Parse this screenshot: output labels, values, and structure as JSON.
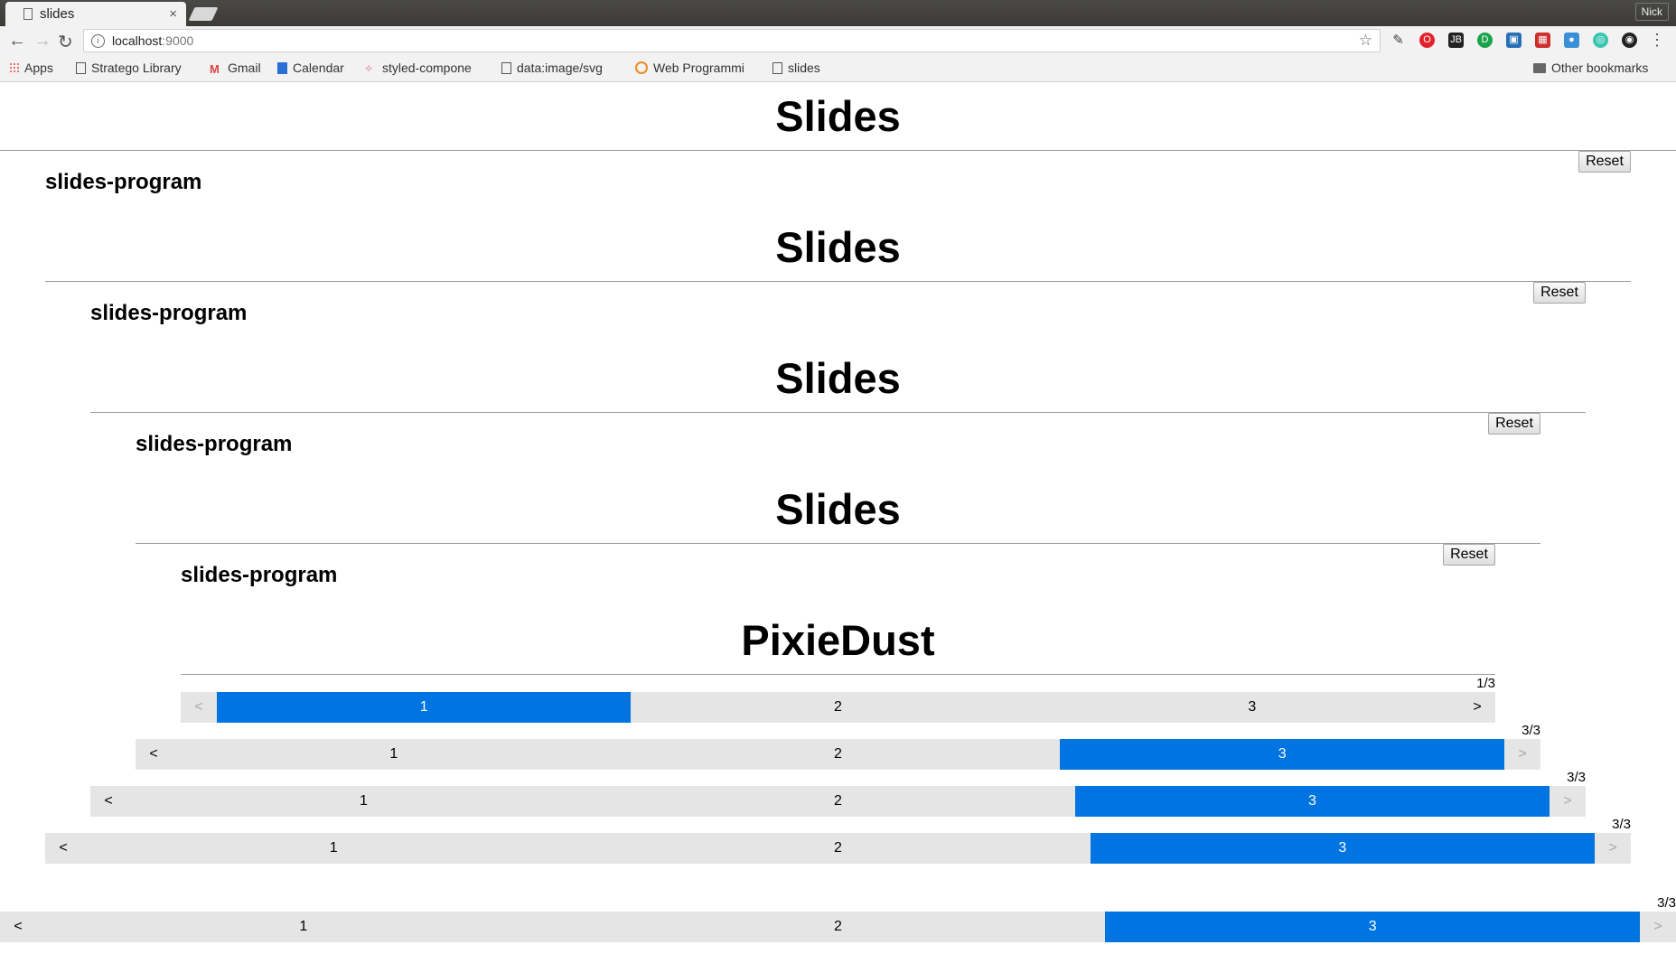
{
  "browser": {
    "tab_title": "slides",
    "tab_close": "×",
    "user": "Nick",
    "url_host": "localhost",
    "url_port": ":9000",
    "bookmarks": [
      "Apps",
      "Stratego Library",
      "Gmail",
      "Calendar",
      "styled-compone",
      "data:image/svg",
      "Web Programmi",
      "slides"
    ],
    "other_bookmarks": "Other bookmarks"
  },
  "headings": {
    "slides": "Slides",
    "program": "slides-program",
    "pixiedust": "PixieDust"
  },
  "buttons": {
    "reset": "Reset"
  },
  "pagers": [
    {
      "counter": "1/3",
      "prev": "<",
      "next": ">",
      "items": [
        "1",
        "2",
        "3"
      ],
      "active": 1
    },
    {
      "counter": "3/3",
      "prev": "<",
      "next": ">",
      "items": [
        "1",
        "2",
        "3"
      ],
      "active": 3
    },
    {
      "counter": "3/3",
      "prev": "<",
      "next": ">",
      "items": [
        "1",
        "2",
        "3"
      ],
      "active": 3
    },
    {
      "counter": "3/3",
      "prev": "<",
      "next": ">",
      "items": [
        "1",
        "2",
        "3"
      ],
      "active": 3
    },
    {
      "counter": "3/3",
      "prev": "<",
      "next": ">",
      "items": [
        "1",
        "2",
        "3"
      ],
      "active": 3
    }
  ],
  "colors": {
    "active": "#0074e0",
    "pager_bg": "#e5e5e5"
  }
}
